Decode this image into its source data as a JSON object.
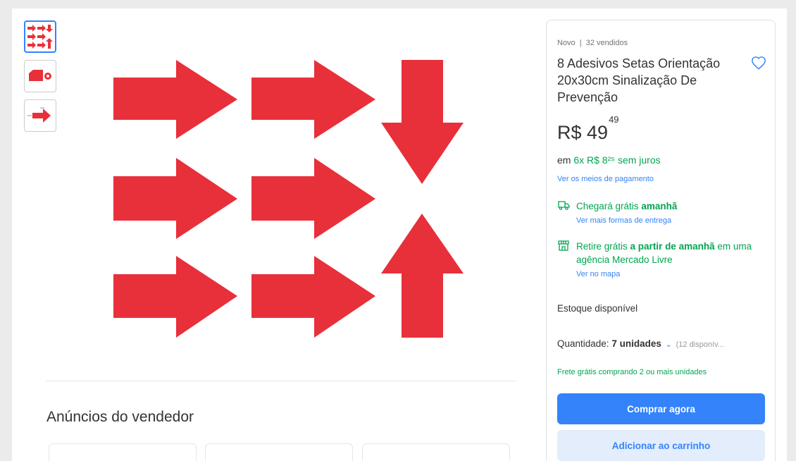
{
  "product": {
    "subtitle": "Novo  |  32 vendidos",
    "title": "8 Adesivos Setas Orientação 20x30cm Sinalização De Prevenção",
    "price": {
      "currency": "R$",
      "integer": "49",
      "cents": "49"
    },
    "installments": {
      "prefix": "em",
      "value": "6x R$ 8²⁵ sem juros"
    },
    "payment_link": "Ver os meios de pagamento",
    "shipping": {
      "text": "Chegará grátis",
      "highlight": "amanhã",
      "link": "Ver mais formas de entrega"
    },
    "pickup": {
      "text1": "Retire grátis",
      "highlight": "a partir de amanhã",
      "text2": "em uma agência Mercado Livre",
      "link": "Ver no mapa"
    },
    "stock": "Estoque disponível",
    "quantity": {
      "label": "Quantidade:",
      "value": "7 unidades",
      "available": "(12 disponív..."
    },
    "free_shipping_note": "Frete grátis comprando 2 ou mais unidades",
    "buy_button": "Comprar agora",
    "cart_button": "Adicionar ao carrinho"
  },
  "seller_section": {
    "title": "Anúncios do vendedor"
  },
  "colors": {
    "accent": "#3483fa",
    "green": "#00a650",
    "arrow_red": "#e8303a"
  },
  "icons": [
    "heart-icon",
    "truck-icon",
    "store-icon",
    "chevron-down-icon"
  ]
}
